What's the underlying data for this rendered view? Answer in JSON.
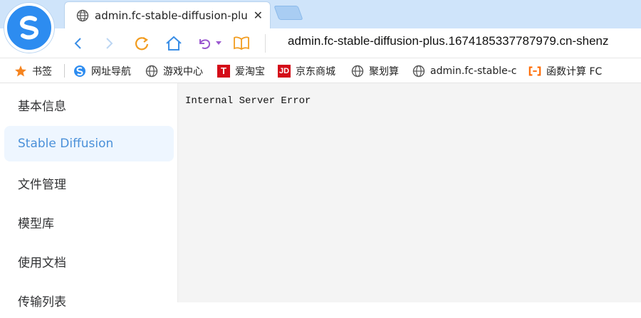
{
  "browser": {
    "tab": {
      "title": "admin.fc-stable-diffusion-plu",
      "close_glyph": "✕",
      "icon": "globe-icon"
    },
    "toolbar": {
      "address": "admin.fc-stable-diffusion-plus.1674185337787979.cn-shenz"
    },
    "bookmarks": [
      {
        "label": "书签",
        "icon": "star-icon"
      },
      {
        "label": "网址导航",
        "icon": "sogou-icon"
      },
      {
        "label": "游戏中心",
        "icon": "globe-icon"
      },
      {
        "label": "爱淘宝",
        "icon": "tmall-icon",
        "glyph": "T"
      },
      {
        "label": "京东商城",
        "icon": "jd-icon",
        "glyph": "JD"
      },
      {
        "label": "聚划算",
        "icon": "globe-icon"
      },
      {
        "label": "admin.fc-stable-c",
        "icon": "globe-icon"
      },
      {
        "label": "函数计算 FC",
        "icon": "aliyun-icon"
      }
    ]
  },
  "sidebar": {
    "items": [
      {
        "label": "基本信息",
        "active": false
      },
      {
        "label": "Stable Diffusion",
        "active": true
      },
      {
        "label": "文件管理",
        "active": false
      },
      {
        "label": "模型库",
        "active": false
      },
      {
        "label": "使用文档",
        "active": false
      },
      {
        "label": "传输列表",
        "active": false
      }
    ]
  },
  "main": {
    "error": "Internal Server Error"
  },
  "colors": {
    "tabstrip": "#cfe4fa",
    "accent": "#2d8cf0",
    "active_item_bg": "#eef6ff",
    "active_item_text": "#4a90d9",
    "main_bg": "#f4f4f4"
  }
}
